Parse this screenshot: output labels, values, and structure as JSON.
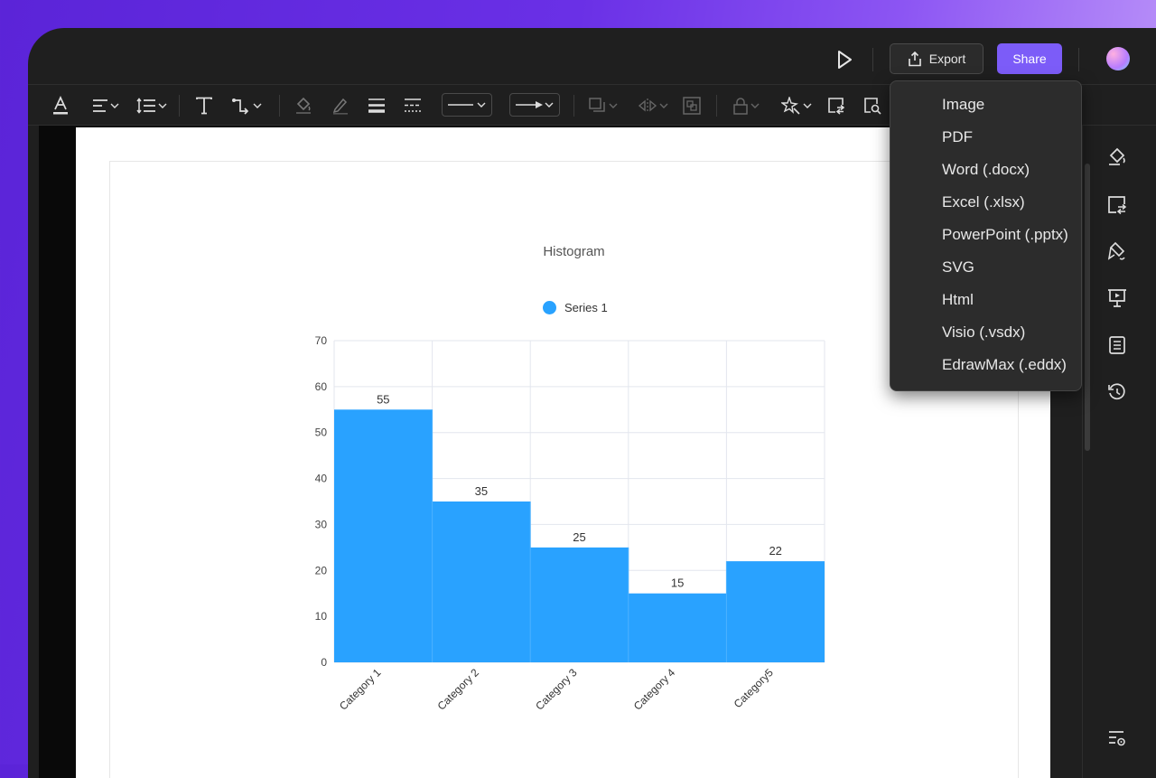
{
  "header": {
    "export_label": "Export",
    "share_label": "Share"
  },
  "export_menu": {
    "items": [
      "Image",
      "PDF",
      "Word (.docx)",
      "Excel (.xlsx)",
      "PowerPoint (.pptx)",
      "SVG",
      "Html",
      "Visio (.vsdx)",
      "EdrawMax (.eddx)"
    ]
  },
  "toolbar": {
    "icons": [
      "text-color-icon",
      "align-icon",
      "line-spacing-icon",
      "text-icon",
      "connector-icon",
      "fill-icon",
      "line-color-icon",
      "line-weight-icon",
      "dash-icon",
      "line-style-dropdown",
      "arrow-style-dropdown",
      "arrange-icon",
      "flip-icon",
      "group-icon",
      "lock-icon",
      "magic-icon",
      "replace-icon",
      "find-icon"
    ]
  },
  "right_panel": {
    "icons": [
      "fill-icon",
      "replace-icon",
      "format-painter-icon",
      "presentation-icon",
      "page-icon",
      "history-icon",
      "settings-icon"
    ]
  },
  "colors": {
    "accent": "#7c5cf8",
    "series": "#29a2ff"
  },
  "chart_data": {
    "type": "bar",
    "title": "Histogram",
    "categories": [
      "Category 1",
      "Category 2",
      "Category 3",
      "Category 4",
      "Category5"
    ],
    "series": [
      {
        "name": "Series 1",
        "values": [
          55,
          35,
          25,
          15,
          22
        ]
      }
    ],
    "ylim": [
      0,
      70
    ],
    "yticks": [
      0,
      10,
      20,
      30,
      40,
      50,
      60,
      70
    ],
    "grid": true,
    "legend": "top"
  }
}
